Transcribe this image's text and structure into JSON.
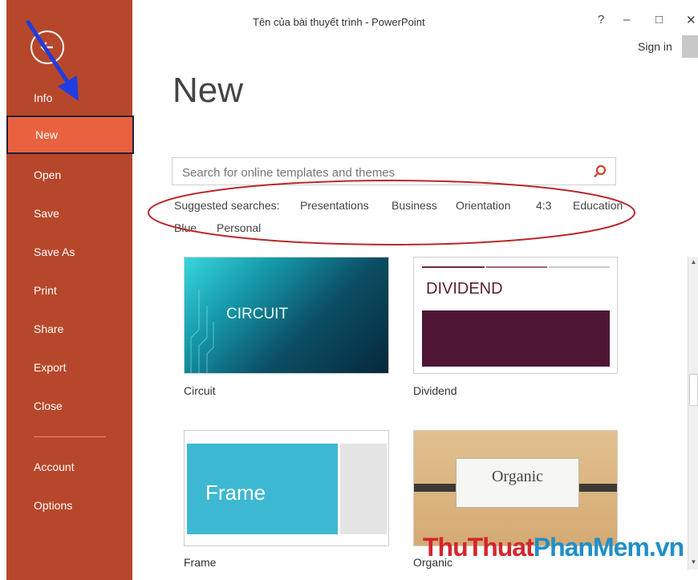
{
  "window": {
    "title": "Tên của bài thuyết trình - PowerPoint",
    "help_glyph": "?",
    "minimize_glyph": "–",
    "maximize_glyph": "□",
    "close_glyph": "✕",
    "sign_in": "Sign in"
  },
  "sidebar": {
    "items": [
      {
        "label": "Info"
      },
      {
        "label": "New",
        "active": true
      },
      {
        "label": "Open"
      },
      {
        "label": "Save"
      },
      {
        "label": "Save As"
      },
      {
        "label": "Print"
      },
      {
        "label": "Share"
      },
      {
        "label": "Export"
      },
      {
        "label": "Close"
      },
      {
        "label": "Account"
      },
      {
        "label": "Options"
      }
    ],
    "colors": {
      "background": "#b7472a",
      "active": "#e8623f"
    }
  },
  "main": {
    "heading": "New",
    "search": {
      "placeholder": "Search for online templates and themes",
      "icon": "search-icon"
    },
    "suggested": {
      "label": "Suggested searches:",
      "links": [
        "Presentations",
        "Business",
        "Orientation",
        "4:3",
        "Education",
        "Blue",
        "Personal"
      ]
    },
    "templates": [
      {
        "name": "Circuit",
        "thumb_text": "CIRCUIT"
      },
      {
        "name": "Dividend",
        "thumb_text": "DIVIDEND"
      },
      {
        "name": "Frame",
        "thumb_text": "Frame"
      },
      {
        "name": "Organic",
        "thumb_text": "Organic"
      }
    ]
  },
  "watermark": {
    "part1": "ThuThuat",
    "part2": "PhanMem.vn"
  }
}
